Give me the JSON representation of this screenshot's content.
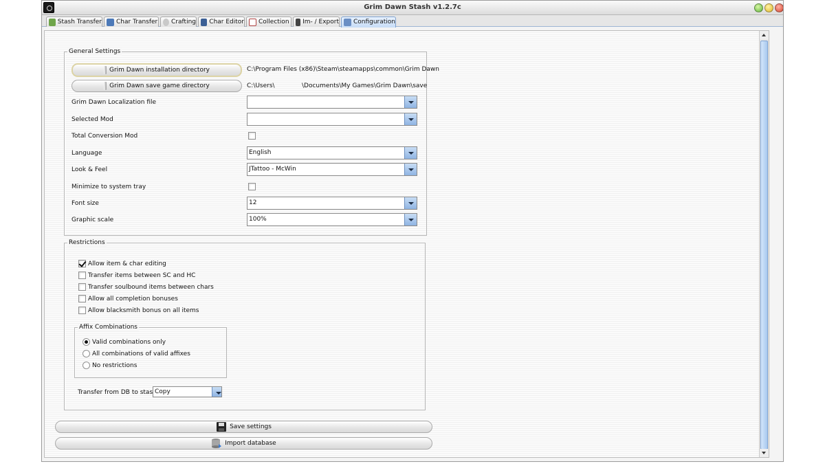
{
  "window": {
    "title": "Grim Dawn Stash v1.2.7c"
  },
  "tabs": [
    {
      "label": "Stash Transfer",
      "icon": "stash-icon"
    },
    {
      "label": "Char Transfer",
      "icon": "char-transfer-icon"
    },
    {
      "label": "Crafting",
      "icon": "crafting-icon"
    },
    {
      "label": "Char Editor",
      "icon": "char-editor-icon"
    },
    {
      "label": "Collection",
      "icon": "collection-icon"
    },
    {
      "label": "Im- / Export",
      "icon": "import-export-icon"
    },
    {
      "label": "Configuration",
      "icon": "configuration-icon",
      "active": true
    }
  ],
  "general": {
    "legend": "General Settings",
    "install_dir_button": "Grim Dawn installation directory",
    "install_dir_path": "C:\\Program Files (x86)\\Steam\\steamapps\\common\\Grim Dawn",
    "save_dir_button": "Grim Dawn save game directory",
    "save_dir_path_a": "C:\\Users\\",
    "save_dir_path_b": "\\Documents\\My Games\\Grim Dawn\\save",
    "localization_label": "Grim Dawn Localization file",
    "localization_value": "",
    "selected_mod_label": "Selected Mod",
    "selected_mod_value": "",
    "total_conversion_label": "Total Conversion Mod",
    "total_conversion_checked": false,
    "language_label": "Language",
    "language_value": "English",
    "look_feel_label": "Look & Feel",
    "look_feel_value": "JTattoo - McWin",
    "tray_label": "Minimize to system tray",
    "tray_checked": false,
    "font_size_label": "Font size",
    "font_size_value": "12",
    "graphic_scale_label": "Graphic scale",
    "graphic_scale_value": "100%"
  },
  "restrictions": {
    "legend": "Restrictions",
    "options": [
      {
        "label": "Allow item & char editing",
        "checked": true
      },
      {
        "label": "Transfer items between SC and HC",
        "checked": false
      },
      {
        "label": "Transfer soulbound items between chars",
        "checked": false
      },
      {
        "label": "Allow all completion bonuses",
        "checked": false
      },
      {
        "label": "Allow blacksmith bonus on all items",
        "checked": false
      }
    ],
    "affix": {
      "legend": "Affix Combinations",
      "options": [
        {
          "label": "Valid combinations only",
          "selected": true
        },
        {
          "label": "All combinations of valid affixes",
          "selected": false
        },
        {
          "label": "No restrictions",
          "selected": false
        }
      ]
    },
    "transfer_label": "Transfer from DB to stash",
    "transfer_value": "Copy"
  },
  "actions": {
    "save_label": "Save settings",
    "import_label": "Import database"
  },
  "colors": {
    "accent": "#8fb4e3",
    "close": "#d4442e",
    "minimize": "#5fb43a",
    "maximize": "#e0b82a"
  }
}
